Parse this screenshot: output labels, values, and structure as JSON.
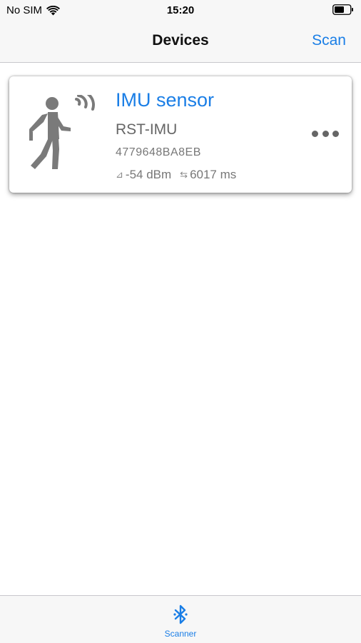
{
  "status_bar": {
    "carrier": "No SIM",
    "time": "15:20",
    "icons": [
      "wifi-icon",
      "battery-icon"
    ]
  },
  "nav": {
    "title": "Devices",
    "scan_label": "Scan"
  },
  "device": {
    "icon": "person-walking-signal-icon",
    "name": "IMU sensor",
    "model": "RST-IMU",
    "id": "4779648BA8EB",
    "rssi_icon": "⊿",
    "rssi": "-54 dBm",
    "interval_icon": "⇆",
    "interval": "6017 ms",
    "more_icon": "more-dots-icon"
  },
  "tab_bar": {
    "tabs": [
      {
        "label": "Scanner",
        "icon": "bluetooth-icon",
        "selected": true
      }
    ]
  },
  "colors": {
    "accent": "#1a7ee6",
    "bar_background": "#f7f7f7",
    "icon_gray": "#7a7a7a"
  }
}
